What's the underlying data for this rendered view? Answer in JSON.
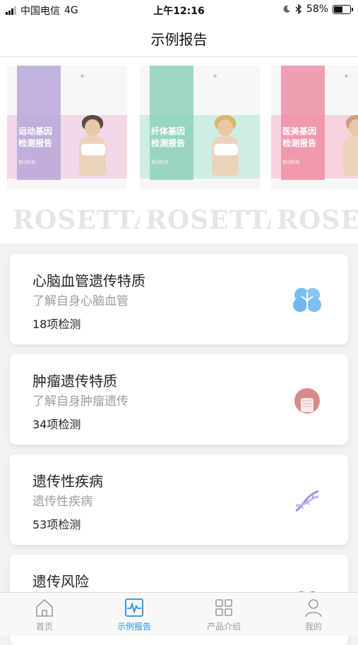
{
  "status": {
    "carrier": "中国电信",
    "network": "4G",
    "time": "上午12:16",
    "battery": "58%",
    "battery_level": 0.58
  },
  "nav": {
    "title": "示例报告"
  },
  "banners": [
    {
      "title_line1": "运动基因",
      "title_line2": "检测报告",
      "subtitle": "基因检测",
      "accent": "#b9a7d8",
      "band": "#f1d7e8",
      "watermark": "ROSETTA"
    },
    {
      "title_line1": "纤体基因",
      "title_line2": "检测报告",
      "subtitle": "基因检测",
      "accent": "#8fd1b8",
      "band": "#cdeee1",
      "watermark": "ROSETTA"
    },
    {
      "title_line1": "医美基因",
      "title_line2": "检测报告",
      "subtitle": "基因检测",
      "accent": "#ef8ea6",
      "band": "#f7d3dd",
      "watermark": "ROSETTA"
    }
  ],
  "categories": [
    {
      "title": "心脑血管遗传特质",
      "subtitle": "了解自身心脑血管",
      "count": "18项检测",
      "icon": "brain-icon",
      "color": "#6fb8ef"
    },
    {
      "title": "肿瘤遗传特质",
      "subtitle": "了解自身肿瘤遗传",
      "count": "34项检测",
      "icon": "tumor-icon",
      "color": "#d98a8a"
    },
    {
      "title": "遗传性疾病",
      "subtitle": "遗传性疾病",
      "count": "53项检测",
      "icon": "dna-icon",
      "color": "#a58fe0"
    },
    {
      "title": "遗传风险",
      "subtitle": "",
      "count": "",
      "icon": "risk-icon",
      "color": "#e25a68"
    }
  ],
  "tabs": [
    {
      "label": "首页",
      "icon": "home-icon",
      "active": false
    },
    {
      "label": "示例报告",
      "icon": "report-icon",
      "active": true
    },
    {
      "label": "产品介绍",
      "icon": "grid-icon",
      "active": false
    },
    {
      "label": "我的",
      "icon": "profile-icon",
      "active": false
    }
  ],
  "colors": {
    "accent": "#2a8de0",
    "inactive": "#9b9b9b"
  }
}
